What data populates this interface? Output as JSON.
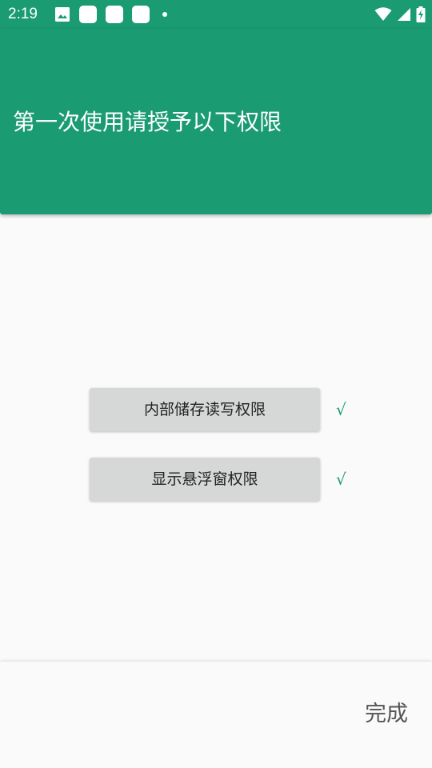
{
  "status_bar": {
    "time": "2:19",
    "left_icons": [
      "image-icon",
      "notification-square-icon",
      "notification-square-icon",
      "notification-square-icon",
      "dot-icon"
    ],
    "right_icons": [
      "wifi-icon",
      "cell-signal-icon",
      "battery-charging-icon"
    ]
  },
  "header": {
    "title": "第一次使用请授予以下权限"
  },
  "permissions": [
    {
      "label": "内部储存读写权限",
      "status": "√"
    },
    {
      "label": "显示悬浮窗权限",
      "status": "√"
    }
  ],
  "footer": {
    "done_label": "完成"
  },
  "colors": {
    "primary": "#1a9b72",
    "button_gray": "#d6d7d7",
    "background": "#fafafa",
    "check": "#1a9b72"
  }
}
